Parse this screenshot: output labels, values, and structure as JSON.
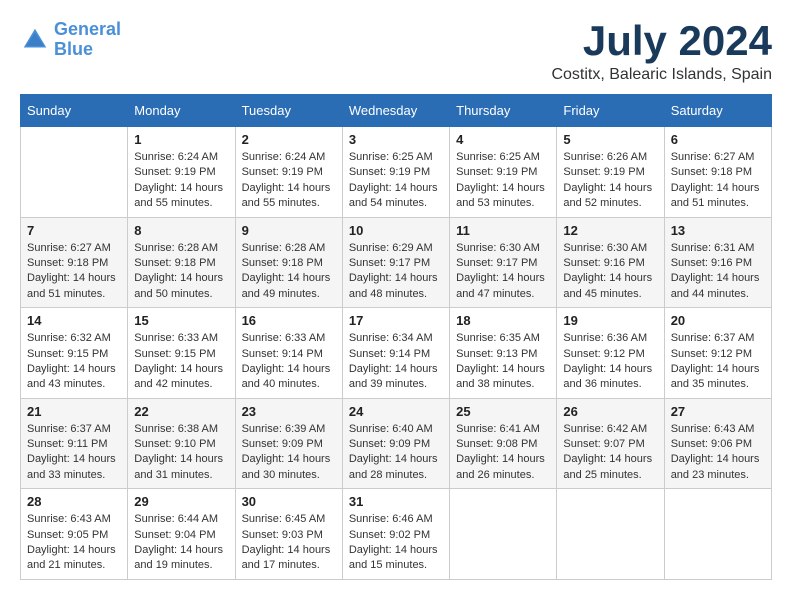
{
  "header": {
    "logo_line1": "General",
    "logo_line2": "Blue",
    "month": "July 2024",
    "location": "Costitx, Balearic Islands, Spain"
  },
  "weekdays": [
    "Sunday",
    "Monday",
    "Tuesday",
    "Wednesday",
    "Thursday",
    "Friday",
    "Saturday"
  ],
  "weeks": [
    [
      {
        "day": "",
        "sunrise": "",
        "sunset": "",
        "daylight": ""
      },
      {
        "day": "1",
        "sunrise": "Sunrise: 6:24 AM",
        "sunset": "Sunset: 9:19 PM",
        "daylight": "Daylight: 14 hours and 55 minutes."
      },
      {
        "day": "2",
        "sunrise": "Sunrise: 6:24 AM",
        "sunset": "Sunset: 9:19 PM",
        "daylight": "Daylight: 14 hours and 55 minutes."
      },
      {
        "day": "3",
        "sunrise": "Sunrise: 6:25 AM",
        "sunset": "Sunset: 9:19 PM",
        "daylight": "Daylight: 14 hours and 54 minutes."
      },
      {
        "day": "4",
        "sunrise": "Sunrise: 6:25 AM",
        "sunset": "Sunset: 9:19 PM",
        "daylight": "Daylight: 14 hours and 53 minutes."
      },
      {
        "day": "5",
        "sunrise": "Sunrise: 6:26 AM",
        "sunset": "Sunset: 9:19 PM",
        "daylight": "Daylight: 14 hours and 52 minutes."
      },
      {
        "day": "6",
        "sunrise": "Sunrise: 6:27 AM",
        "sunset": "Sunset: 9:18 PM",
        "daylight": "Daylight: 14 hours and 51 minutes."
      }
    ],
    [
      {
        "day": "7",
        "sunrise": "Sunrise: 6:27 AM",
        "sunset": "Sunset: 9:18 PM",
        "daylight": "Daylight: 14 hours and 51 minutes."
      },
      {
        "day": "8",
        "sunrise": "Sunrise: 6:28 AM",
        "sunset": "Sunset: 9:18 PM",
        "daylight": "Daylight: 14 hours and 50 minutes."
      },
      {
        "day": "9",
        "sunrise": "Sunrise: 6:28 AM",
        "sunset": "Sunset: 9:18 PM",
        "daylight": "Daylight: 14 hours and 49 minutes."
      },
      {
        "day": "10",
        "sunrise": "Sunrise: 6:29 AM",
        "sunset": "Sunset: 9:17 PM",
        "daylight": "Daylight: 14 hours and 48 minutes."
      },
      {
        "day": "11",
        "sunrise": "Sunrise: 6:30 AM",
        "sunset": "Sunset: 9:17 PM",
        "daylight": "Daylight: 14 hours and 47 minutes."
      },
      {
        "day": "12",
        "sunrise": "Sunrise: 6:30 AM",
        "sunset": "Sunset: 9:16 PM",
        "daylight": "Daylight: 14 hours and 45 minutes."
      },
      {
        "day": "13",
        "sunrise": "Sunrise: 6:31 AM",
        "sunset": "Sunset: 9:16 PM",
        "daylight": "Daylight: 14 hours and 44 minutes."
      }
    ],
    [
      {
        "day": "14",
        "sunrise": "Sunrise: 6:32 AM",
        "sunset": "Sunset: 9:15 PM",
        "daylight": "Daylight: 14 hours and 43 minutes."
      },
      {
        "day": "15",
        "sunrise": "Sunrise: 6:33 AM",
        "sunset": "Sunset: 9:15 PM",
        "daylight": "Daylight: 14 hours and 42 minutes."
      },
      {
        "day": "16",
        "sunrise": "Sunrise: 6:33 AM",
        "sunset": "Sunset: 9:14 PM",
        "daylight": "Daylight: 14 hours and 40 minutes."
      },
      {
        "day": "17",
        "sunrise": "Sunrise: 6:34 AM",
        "sunset": "Sunset: 9:14 PM",
        "daylight": "Daylight: 14 hours and 39 minutes."
      },
      {
        "day": "18",
        "sunrise": "Sunrise: 6:35 AM",
        "sunset": "Sunset: 9:13 PM",
        "daylight": "Daylight: 14 hours and 38 minutes."
      },
      {
        "day": "19",
        "sunrise": "Sunrise: 6:36 AM",
        "sunset": "Sunset: 9:12 PM",
        "daylight": "Daylight: 14 hours and 36 minutes."
      },
      {
        "day": "20",
        "sunrise": "Sunrise: 6:37 AM",
        "sunset": "Sunset: 9:12 PM",
        "daylight": "Daylight: 14 hours and 35 minutes."
      }
    ],
    [
      {
        "day": "21",
        "sunrise": "Sunrise: 6:37 AM",
        "sunset": "Sunset: 9:11 PM",
        "daylight": "Daylight: 14 hours and 33 minutes."
      },
      {
        "day": "22",
        "sunrise": "Sunrise: 6:38 AM",
        "sunset": "Sunset: 9:10 PM",
        "daylight": "Daylight: 14 hours and 31 minutes."
      },
      {
        "day": "23",
        "sunrise": "Sunrise: 6:39 AM",
        "sunset": "Sunset: 9:09 PM",
        "daylight": "Daylight: 14 hours and 30 minutes."
      },
      {
        "day": "24",
        "sunrise": "Sunrise: 6:40 AM",
        "sunset": "Sunset: 9:09 PM",
        "daylight": "Daylight: 14 hours and 28 minutes."
      },
      {
        "day": "25",
        "sunrise": "Sunrise: 6:41 AM",
        "sunset": "Sunset: 9:08 PM",
        "daylight": "Daylight: 14 hours and 26 minutes."
      },
      {
        "day": "26",
        "sunrise": "Sunrise: 6:42 AM",
        "sunset": "Sunset: 9:07 PM",
        "daylight": "Daylight: 14 hours and 25 minutes."
      },
      {
        "day": "27",
        "sunrise": "Sunrise: 6:43 AM",
        "sunset": "Sunset: 9:06 PM",
        "daylight": "Daylight: 14 hours and 23 minutes."
      }
    ],
    [
      {
        "day": "28",
        "sunrise": "Sunrise: 6:43 AM",
        "sunset": "Sunset: 9:05 PM",
        "daylight": "Daylight: 14 hours and 21 minutes."
      },
      {
        "day": "29",
        "sunrise": "Sunrise: 6:44 AM",
        "sunset": "Sunset: 9:04 PM",
        "daylight": "Daylight: 14 hours and 19 minutes."
      },
      {
        "day": "30",
        "sunrise": "Sunrise: 6:45 AM",
        "sunset": "Sunset: 9:03 PM",
        "daylight": "Daylight: 14 hours and 17 minutes."
      },
      {
        "day": "31",
        "sunrise": "Sunrise: 6:46 AM",
        "sunset": "Sunset: 9:02 PM",
        "daylight": "Daylight: 14 hours and 15 minutes."
      },
      {
        "day": "",
        "sunrise": "",
        "sunset": "",
        "daylight": ""
      },
      {
        "day": "",
        "sunrise": "",
        "sunset": "",
        "daylight": ""
      },
      {
        "day": "",
        "sunrise": "",
        "sunset": "",
        "daylight": ""
      }
    ]
  ]
}
